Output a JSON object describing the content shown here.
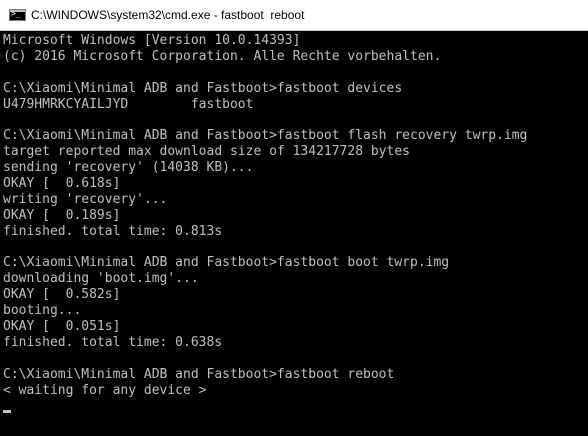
{
  "window": {
    "title": "C:\\WINDOWS\\system32\\cmd.exe - fastboot  reboot",
    "icon": "cmd-console-icon"
  },
  "console": {
    "lines": [
      "Microsoft Windows [Version 10.0.14393]",
      "(c) 2016 Microsoft Corporation. Alle Rechte vorbehalten.",
      "",
      "C:\\Xiaomi\\Minimal ADB and Fastboot>fastboot devices",
      "U479HMRKCYAILJYD        fastboot",
      "",
      "C:\\Xiaomi\\Minimal ADB and Fastboot>fastboot flash recovery twrp.img",
      "target reported max download size of 134217728 bytes",
      "sending 'recovery' (14038 KB)...",
      "OKAY [  0.618s]",
      "writing 'recovery'...",
      "OKAY [  0.189s]",
      "finished. total time: 0.813s",
      "",
      "C:\\Xiaomi\\Minimal ADB and Fastboot>fastboot boot twrp.img",
      "downloading 'boot.img'...",
      "OKAY [  0.582s]",
      "booting...",
      "OKAY [  0.051s]",
      "finished. total time: 0.638s",
      "",
      "C:\\Xiaomi\\Minimal ADB and Fastboot>fastboot reboot",
      "< waiting for any device >",
      ""
    ]
  },
  "colors": {
    "console_background": "#000000",
    "console_text": "#c0c0c0",
    "titlebar_background": "#ffffff",
    "titlebar_text": "#000000"
  }
}
